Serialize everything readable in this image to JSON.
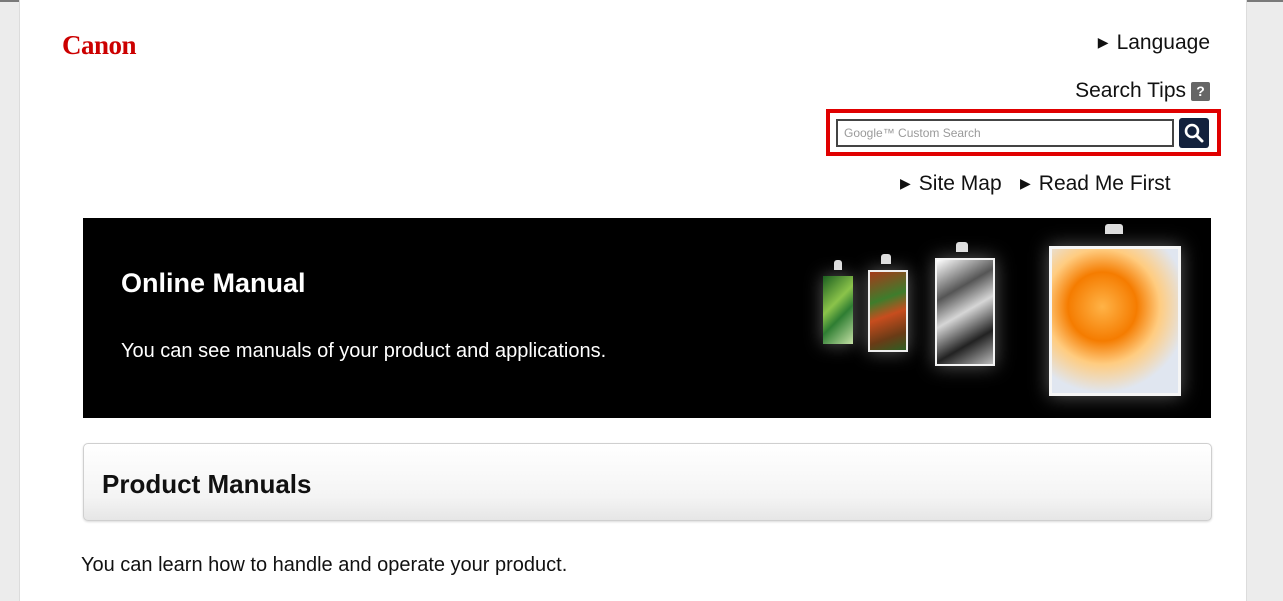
{
  "header": {
    "logo_text": "Canon",
    "language_label": "Language",
    "search_tips_label": "Search Tips",
    "search_placeholder": "Google™ Custom Search",
    "site_map_label": "Site Map",
    "read_me_first_label": "Read Me First"
  },
  "banner": {
    "title": "Online Manual",
    "description": "You can see manuals of your product and applications."
  },
  "section": {
    "title": "Product Manuals",
    "description": "You can learn how to handle and operate your product."
  },
  "colors": {
    "brand_red": "#cc0000",
    "highlight_border": "#e00000",
    "search_button": "#12213d"
  },
  "icons": [
    "arrow-right-icon",
    "help-icon",
    "search-icon"
  ]
}
